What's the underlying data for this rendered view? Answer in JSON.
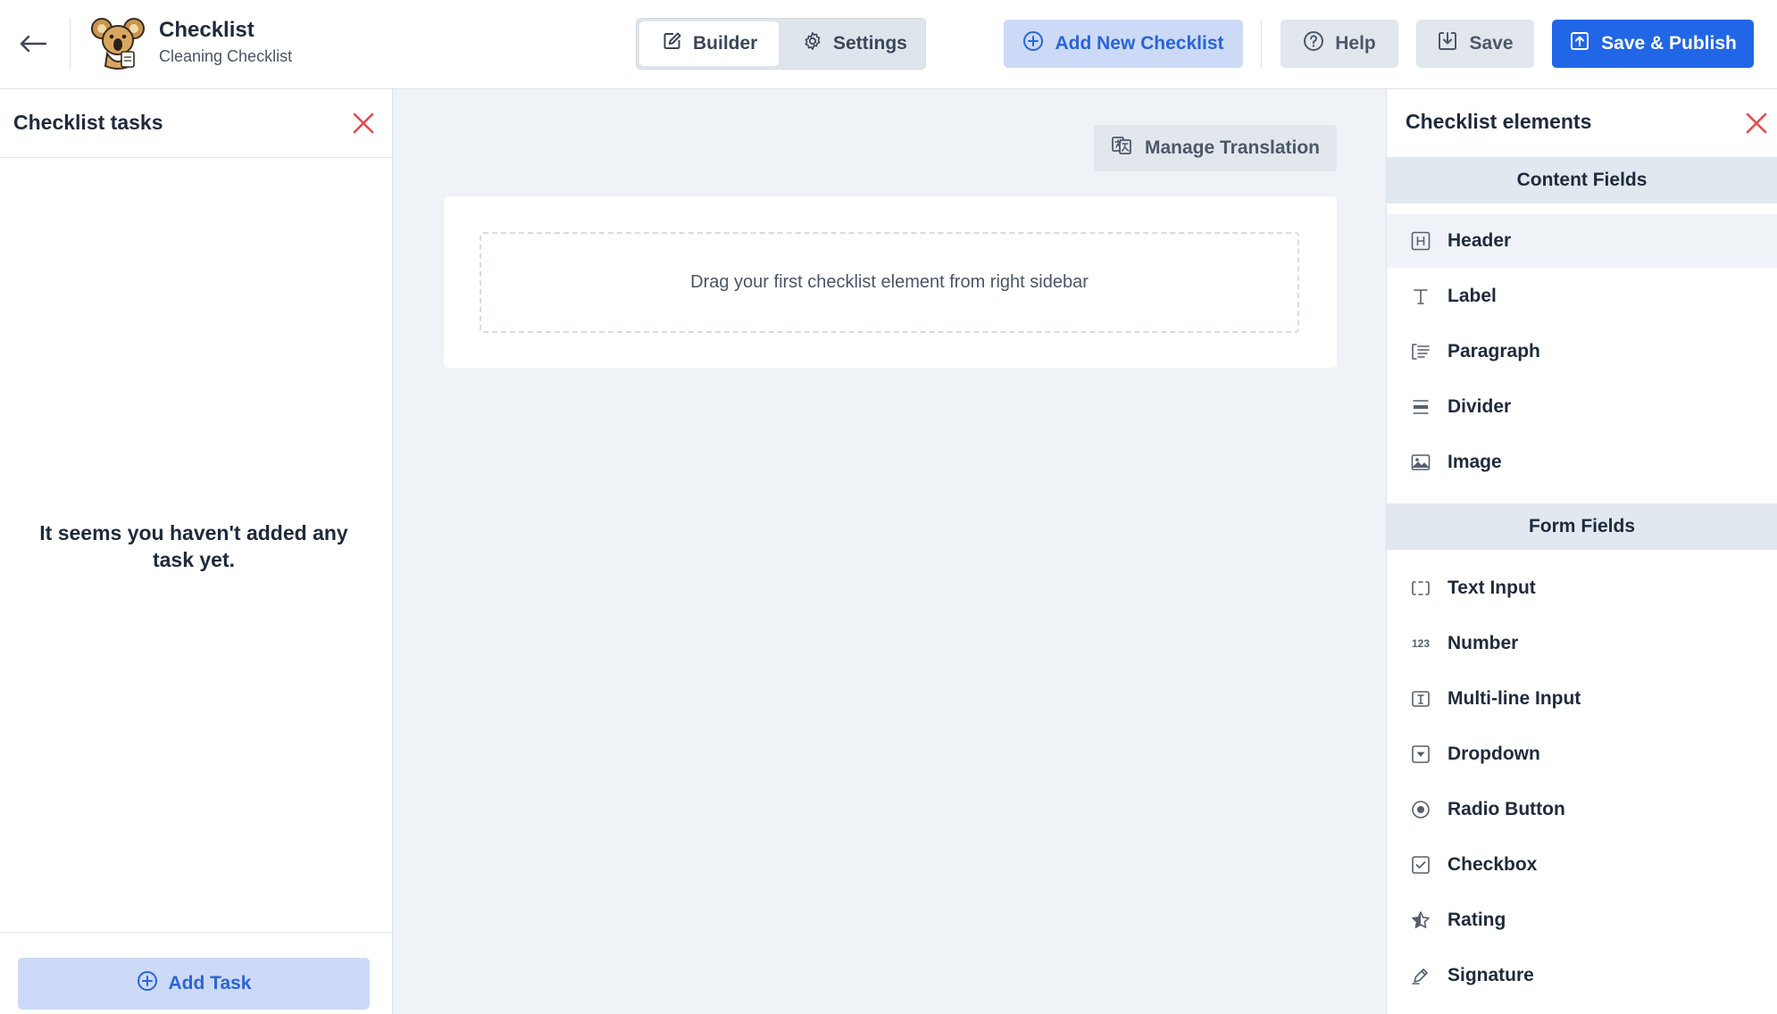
{
  "header": {
    "app_title": "Checklist",
    "app_subtitle": "Cleaning Checklist",
    "modes": {
      "builder": "Builder",
      "settings": "Settings",
      "active": "builder"
    },
    "actions": {
      "add_checklist": "Add New Checklist",
      "help": "Help",
      "save": "Save",
      "publish": "Save & Publish"
    }
  },
  "left_panel": {
    "title": "Checklist tasks",
    "empty_message": "It seems you haven't added any task yet.",
    "add_task": "Add Task"
  },
  "canvas": {
    "manage_translation": "Manage Translation",
    "drop_hint": "Drag your first checklist element from right sidebar"
  },
  "right_panel": {
    "title": "Checklist elements",
    "sections": [
      {
        "title": "Content Fields",
        "items": [
          {
            "label": "Header",
            "icon": "header-icon",
            "highlighted": true
          },
          {
            "label": "Label",
            "icon": "text-icon"
          },
          {
            "label": "Paragraph",
            "icon": "paragraph-icon"
          },
          {
            "label": "Divider",
            "icon": "divider-icon"
          },
          {
            "label": "Image",
            "icon": "image-icon"
          }
        ]
      },
      {
        "title": "Form Fields",
        "items": [
          {
            "label": "Text Input",
            "icon": "text-input-icon"
          },
          {
            "label": "Number",
            "icon": "number-icon",
            "glyph": "123"
          },
          {
            "label": "Multi-line Input",
            "icon": "multiline-input-icon"
          },
          {
            "label": "Dropdown",
            "icon": "dropdown-icon"
          },
          {
            "label": "Radio Button",
            "icon": "radio-icon"
          },
          {
            "label": "Checkbox",
            "icon": "checkbox-icon"
          },
          {
            "label": "Rating",
            "icon": "star-icon"
          },
          {
            "label": "Signature",
            "icon": "pen-icon"
          }
        ]
      }
    ]
  },
  "colors": {
    "primary": "#2166e6",
    "primary_soft": "#ccdaf7",
    "close": "#e5484d",
    "background": "#eff3f7"
  }
}
